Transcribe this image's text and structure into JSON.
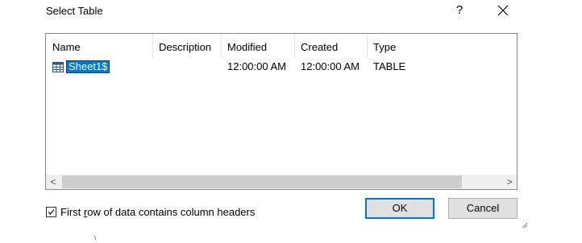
{
  "dialog": {
    "title": "Select Table",
    "help_label": "?"
  },
  "table": {
    "columns": [
      "Name",
      "Description",
      "Modified",
      "Created",
      "Type"
    ],
    "rows": [
      {
        "name": "Sheet1$",
        "description": "",
        "modified": "12:00:00 AM",
        "created": "12:00:00 AM",
        "type": "TABLE",
        "icon": "table-icon",
        "selected": true
      }
    ]
  },
  "scrollbar": {
    "left_arrow": "<",
    "right_arrow": ">"
  },
  "options": {
    "first_row_headers_prefix": "First ",
    "first_row_headers_accel": "r",
    "first_row_headers_suffix": "ow of data contains column headers",
    "first_row_headers_checked": true
  },
  "buttons": {
    "ok_label": "OK",
    "cancel_label": "Cancel"
  },
  "colors": {
    "selection": "#0078d7",
    "default_button_border": "#0078d7"
  }
}
